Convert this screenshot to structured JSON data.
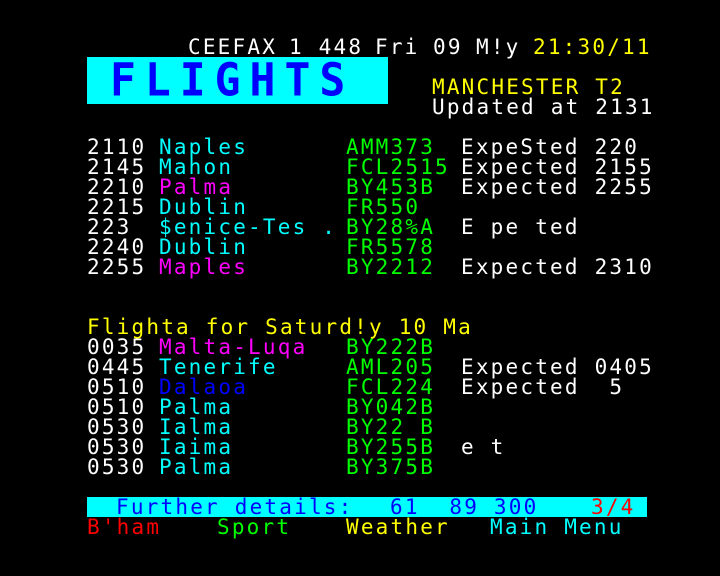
{
  "header": {
    "service": "CEEFAX",
    "page_number": "1 448",
    "day": "Fri",
    "date": "09",
    "month": "M!y",
    "time": "21:30/11"
  },
  "banner": {
    "title": "FLIGHTS"
  },
  "airport": {
    "name": "MANCHESTER T2",
    "updated": "Updated at 2131"
  },
  "tonight": [
    {
      "time": "2110",
      "dest": "Naples",
      "flight": "AMM373",
      "status": "ExpeSted 220"
    },
    {
      "time": "2145",
      "dest": "Mahon",
      "flight": "FCL2515",
      "status": "Expected 2155"
    },
    {
      "time": "2210",
      "dest": "Palma",
      "flight": "BY453B",
      "status": "Expected 2255"
    },
    {
      "time": "2215",
      "dest": "Dublin",
      "flight": "FR550",
      "status": ""
    },
    {
      "time": "223",
      "dest": "$enice-Tes .",
      "flight": "BY28%A",
      "status": "E pe ted"
    },
    {
      "time": "2240",
      "dest": "Dublin",
      "flight": "FR5578",
      "status": ""
    },
    {
      "time": "2255",
      "dest": "Maples",
      "flight": "BY2212",
      "status": "Expected 2310"
    }
  ],
  "saturday_heading": "Flighta for Saturd!y 10 Ma",
  "saturday": [
    {
      "time": "0035",
      "dest": "Malta-Luqa",
      "flight": "BY222B",
      "status": ""
    },
    {
      "time": "0445",
      "dest": "Tenerife",
      "flight": "AML205",
      "status": "Expected 0405"
    },
    {
      "time": "0510",
      "dest": "Dalaoa",
      "flight": "FCL224",
      "status": "Expected  5"
    },
    {
      "time": "0510",
      "dest": "Palma",
      "flight": "BY042B",
      "status": ""
    },
    {
      "time": "0530",
      "dest": "Ialma",
      "flight": "BY22 B",
      "status": ""
    },
    {
      "time": "0530",
      "dest": "Iaima",
      "flight": "BY255B",
      "status": "e t"
    },
    {
      "time": "0530",
      "dest": "Palma",
      "flight": "BY375B",
      "status": ""
    }
  ],
  "footer": {
    "details_label": "Further details:",
    "phone": "61  89 300",
    "page_index": "3/4"
  },
  "fastext": {
    "red": "B'ham",
    "green": "Sport",
    "yellow": "Weather",
    "cyan": "Main Menu"
  },
  "colors": {
    "background": "#000000",
    "white": "#ffffff",
    "yellow": "#ffff00",
    "cyan": "#00ffff",
    "magenta": "#ff00ff",
    "green": "#00ff00",
    "red": "#ff0000",
    "blue": "#0000ff"
  }
}
